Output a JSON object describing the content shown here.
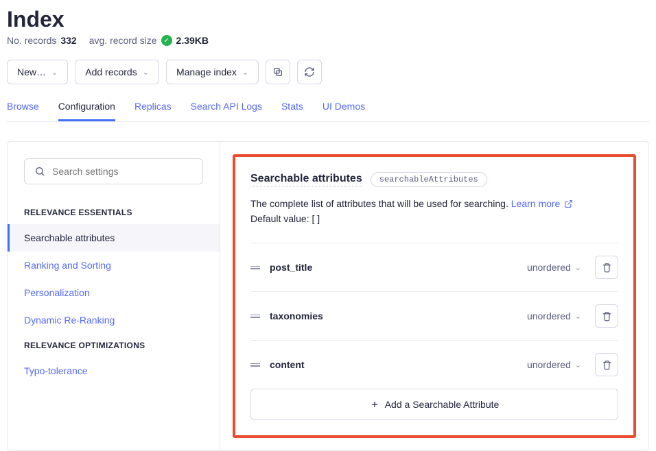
{
  "header": {
    "title": "Index",
    "records_label": "No. records",
    "records_value": "332",
    "avg_label": "avg. record size",
    "avg_value": "2.39KB"
  },
  "toolbar": {
    "new_label": "New…",
    "add_records_label": "Add records",
    "manage_index_label": "Manage index"
  },
  "tabs": [
    "Browse",
    "Configuration",
    "Replicas",
    "Search API Logs",
    "Stats",
    "UI Demos"
  ],
  "tabs_active_index": 1,
  "sidebar": {
    "search_placeholder": "Search settings",
    "sections": [
      {
        "title": "RELEVANCE ESSENTIALS",
        "items": [
          "Searchable attributes",
          "Ranking and Sorting",
          "Personalization",
          "Dynamic Re-Ranking"
        ],
        "active_index": 0
      },
      {
        "title": "RELEVANCE OPTIMIZATIONS",
        "items": [
          "Typo-tolerance"
        ],
        "active_index": -1
      }
    ]
  },
  "main": {
    "section_title": "Searchable attributes",
    "api_name": "searchableAttributes",
    "description": "The complete list of attributes that will be used for searching. ",
    "learn_more": "Learn more",
    "default_label": "Default value: [ ]",
    "attributes": [
      {
        "name": "post_title",
        "mode": "unordered"
      },
      {
        "name": "taxonomies",
        "mode": "unordered"
      },
      {
        "name": "content",
        "mode": "unordered"
      }
    ],
    "add_label": "Add a Searchable Attribute"
  }
}
